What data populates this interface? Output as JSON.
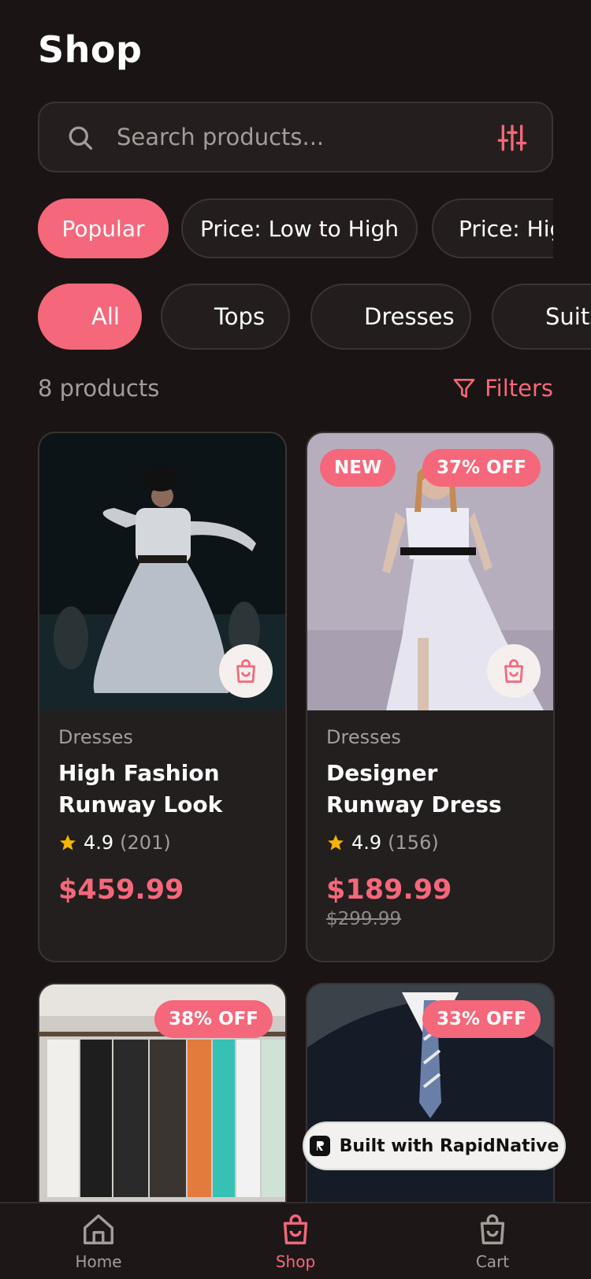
{
  "header": {
    "title": "Shop"
  },
  "search": {
    "placeholder": "Search products..."
  },
  "sort_options": [
    {
      "label": "Popular",
      "active": true
    },
    {
      "label": "Price: Low to High",
      "active": false
    },
    {
      "label": "Price: High to Low",
      "active": false
    }
  ],
  "categories": [
    {
      "label": "All",
      "active": true
    },
    {
      "label": "Tops",
      "active": false
    },
    {
      "label": "Dresses",
      "active": false
    },
    {
      "label": "Suits",
      "active": false
    }
  ],
  "results": {
    "count_text": "8 products",
    "filters_label": "Filters"
  },
  "products": [
    {
      "category": "Dresses",
      "name": "High Fashion Runway Look",
      "rating": "4.9",
      "reviews": "(201)",
      "price": "$459.99",
      "badges": []
    },
    {
      "category": "Dresses",
      "name": "Designer Runway Dress",
      "rating": "4.9",
      "reviews": "(156)",
      "price": "$189.99",
      "old_price": "$299.99",
      "badges": [
        "NEW",
        "37% OFF"
      ]
    },
    {
      "badges": [
        "38% OFF"
      ]
    },
    {
      "badges": [
        "33% OFF"
      ]
    }
  ],
  "watermark": {
    "label": "Built with RapidNative"
  },
  "tabbar": {
    "items": [
      {
        "label": "Home",
        "icon": "home-icon",
        "active": false
      },
      {
        "label": "Shop",
        "icon": "bag-icon",
        "active": true
      },
      {
        "label": "Cart",
        "icon": "bag-icon",
        "active": false
      }
    ]
  },
  "colors": {
    "accent": "#f5677b",
    "background": "#1a1514",
    "card": "#231f1e",
    "star": "#f5b400"
  }
}
